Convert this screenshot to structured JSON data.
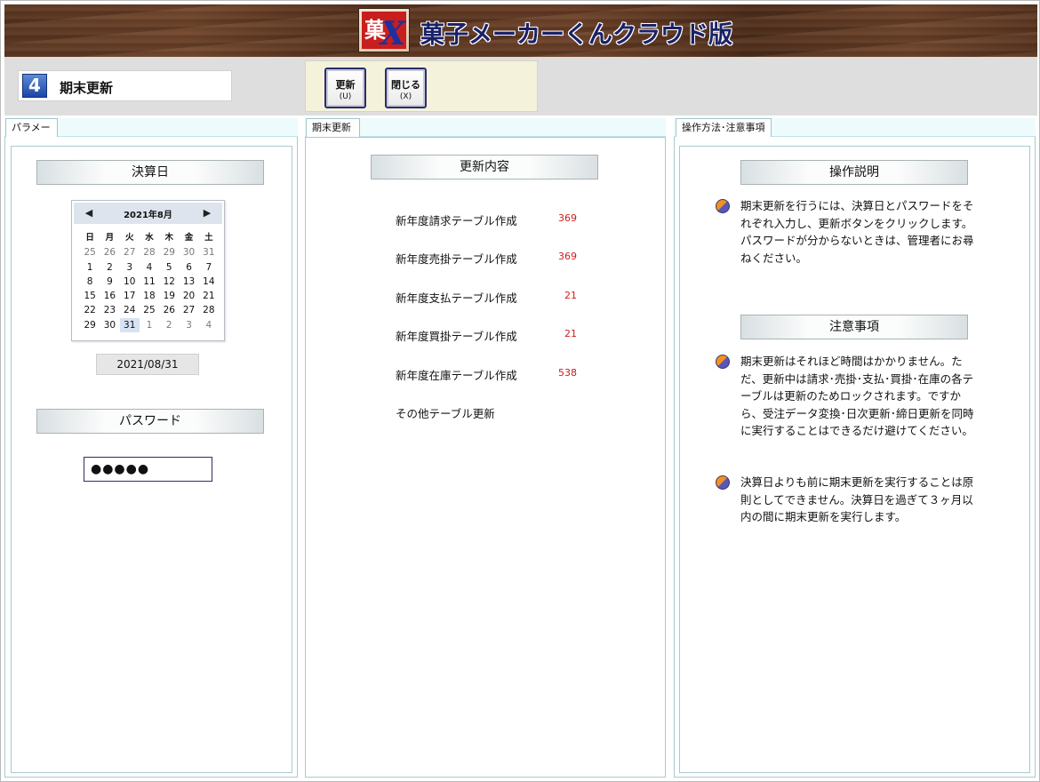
{
  "header": {
    "app_title": "菓子メーカーくんクラウド版",
    "logo_text": "菓X"
  },
  "toolbar": {
    "screen_number": "4",
    "screen_name": "期末更新",
    "update_button": {
      "label": "更新",
      "shortcut": "(U)"
    },
    "close_button": {
      "label": "閉じる",
      "shortcut": "(X)"
    }
  },
  "left_panel": {
    "tab": "パラメータ",
    "closing_date_heading": "決算日",
    "calendar": {
      "month_label": "2021年8月",
      "prev_symbol": "◀",
      "next_symbol": "▶",
      "weekdays": [
        "日",
        "月",
        "火",
        "水",
        "木",
        "金",
        "土"
      ],
      "weeks": [
        [
          "25",
          "26",
          "27",
          "28",
          "29",
          "30",
          "31"
        ],
        [
          "1",
          "2",
          "3",
          "4",
          "5",
          "6",
          "7"
        ],
        [
          "8",
          "9",
          "10",
          "11",
          "12",
          "13",
          "14"
        ],
        [
          "15",
          "16",
          "17",
          "18",
          "19",
          "20",
          "21"
        ],
        [
          "22",
          "23",
          "24",
          "25",
          "26",
          "27",
          "28"
        ],
        [
          "29",
          "30",
          "31",
          "1",
          "2",
          "3",
          "4"
        ]
      ],
      "selected_day": "31"
    },
    "selected_date": "2021/08/31",
    "password_heading": "パスワード",
    "password_value": "●●●●●"
  },
  "middle_panel": {
    "tab": "期末更新",
    "heading": "更新内容",
    "items": [
      {
        "label": "新年度請求テーブル作成",
        "count": "369"
      },
      {
        "label": "新年度売掛テーブル作成",
        "count": "369"
      },
      {
        "label": "新年度支払テーブル作成",
        "count": "21"
      },
      {
        "label": "新年度買掛テーブル作成",
        "count": "21"
      },
      {
        "label": "新年度在庫テーブル作成",
        "count": "538"
      },
      {
        "label": "その他テーブル更新",
        "count": ""
      }
    ]
  },
  "right_panel": {
    "tab": "操作方法･注意事項",
    "instructions_heading": "操作説明",
    "instructions": "期末更新を行うには、決算日とパスワードをそれぞれ入力し、更新ボタンをクリックします。パスワードが分からないときは、管理者にお尋ねください。",
    "notes_heading": "注意事項",
    "notes": [
      "期末更新はそれほど時間はかかりません。ただ、更新中は請求･売掛･支払･買掛･在庫の各テーブルは更新のためロックされます。ですから、受注データ変換･日次更新･締日更新を同時に実行することはできるだけ避けてください。",
      "決算日よりも前に期末更新を実行することは原則としてできません。決算日を過ぎて３ヶ月以内の間に期末更新を実行します。"
    ]
  },
  "colors": {
    "title_text": "#1a2168",
    "count_text": "#d21b1b",
    "screen_badge": "#1d47a6"
  }
}
